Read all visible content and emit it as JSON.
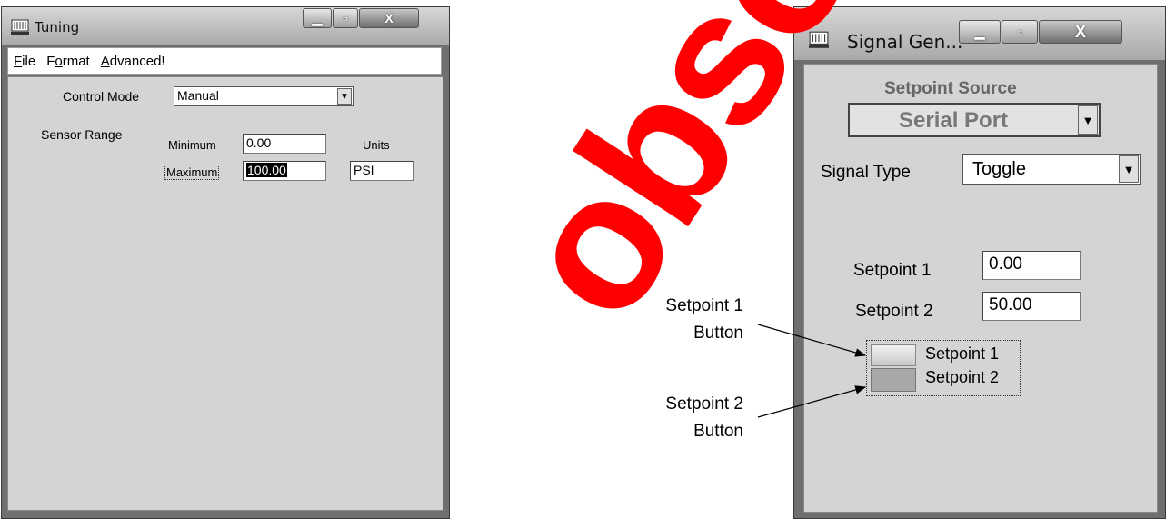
{
  "tuning": {
    "title": "Tuning",
    "menu": {
      "file_u": "F",
      "file_rest": "ile",
      "format_a": "F",
      "format_u": "o",
      "format_rest": "rmat",
      "adv_u": "A",
      "adv_rest": "dvanced!"
    },
    "control_mode_label": "Control Mode",
    "control_mode_value": "Manual",
    "sensor_range_label": "Sensor Range",
    "minimum_label": "Minimum",
    "minimum_value": "0.00",
    "maximum_label": "Maximum",
    "maximum_value": "100.00",
    "units_label": "Units",
    "units_value": "PSI"
  },
  "signal": {
    "title": "Signal Gen...",
    "setpoint_source_label": "Setpoint Source",
    "setpoint_source_value": "Serial Port",
    "signal_type_label": "Signal Type",
    "signal_type_value": "Toggle",
    "setpoint1_label": "Setpoint 1",
    "setpoint1_value": "0.00",
    "setpoint2_label": "Setpoint 2",
    "setpoint2_value": "50.00",
    "radio1_label": "Setpoint 1",
    "radio2_label": "Setpoint 2"
  },
  "annotations": {
    "sp1_line1": "Setpoint 1",
    "sp1_line2": "Button",
    "sp2_line1": "Setpoint 2",
    "sp2_line2": "Button"
  },
  "watermark": {
    "text": "obsolete",
    "color": "#ff0000"
  },
  "icons": {
    "app": "app-window-icon",
    "minimize": "minimize-icon",
    "maximize": "maximize-icon",
    "close": "close-icon",
    "dropdown": "chevron-down-icon"
  }
}
